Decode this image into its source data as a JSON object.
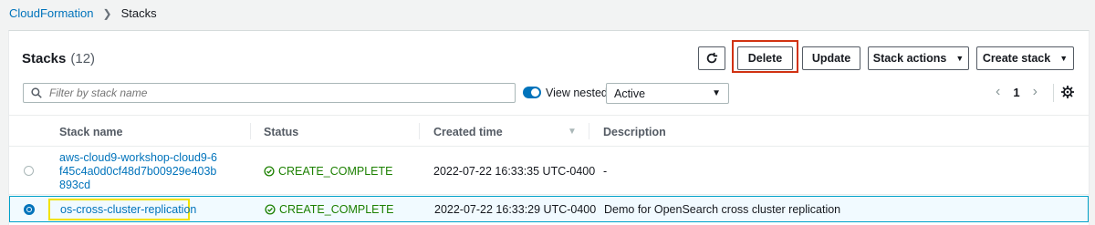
{
  "breadcrumb": {
    "root": "CloudFormation",
    "current": "Stacks"
  },
  "panel": {
    "title": "Stacks",
    "count": "(12)",
    "buttons": {
      "delete": "Delete",
      "update": "Update",
      "stack_actions": "Stack actions",
      "create_stack": "Create stack"
    }
  },
  "filter": {
    "placeholder": "Filter by stack name",
    "view_nested_label": "View nested",
    "status_selected": "Active"
  },
  "pagination": {
    "page": "1"
  },
  "table": {
    "columns": [
      "Stack name",
      "Status",
      "Created time",
      "Description"
    ],
    "rows": [
      {
        "name": "aws-cloud9-workshop-cloud9-6f45c4a0d0cf48d7b00929e403b893cd",
        "status": "CREATE_COMPLETE",
        "created": "2022-07-22 16:33:35 UTC-0400",
        "description": "-",
        "selected": false
      },
      {
        "name": "os-cross-cluster-replication",
        "status": "CREATE_COMPLETE",
        "created": "2022-07-22 16:33:29 UTC-0400",
        "description": "Demo for OpenSearch cross cluster replication",
        "selected": true
      }
    ]
  },
  "colors": {
    "link": "#0073bb",
    "success": "#1d8102",
    "highlight_red": "#d13212",
    "highlight_yellow": "#f2e200"
  }
}
